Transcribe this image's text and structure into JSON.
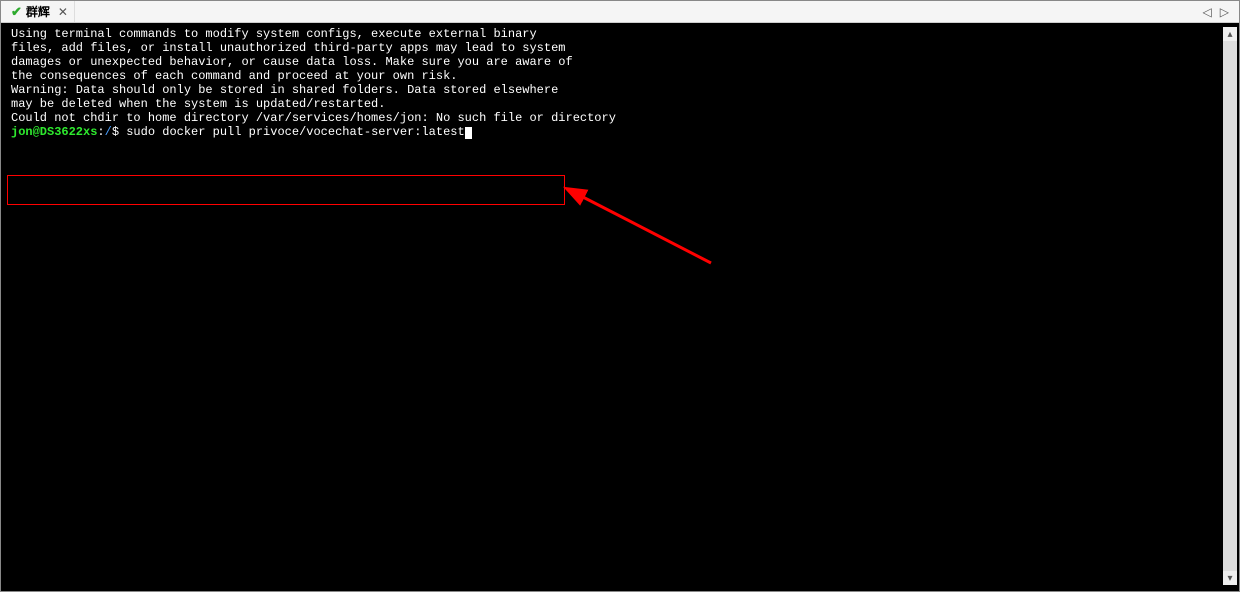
{
  "tab": {
    "title": "群辉"
  },
  "terminal": {
    "motd": [
      "",
      "Using terminal commands to modify system configs, execute external binary",
      "files, add files, or install unauthorized third-party apps may lead to system",
      "damages or unexpected behavior, or cause data loss. Make sure you are aware of",
      "the consequences of each command and proceed at your own risk.",
      "",
      "Warning: Data should only be stored in shared folders. Data stored elsewhere",
      "may be deleted when the system is updated/restarted.",
      "",
      "Could not chdir to home directory /var/services/homes/jon: No such file or directory"
    ],
    "prompt": {
      "userhost": "jon@DS3622xs",
      "sep": ":",
      "path": "/",
      "symbol": "$"
    },
    "command": "sudo docker pull privoce/vocechat-server:latest"
  },
  "annotation": {
    "highlight_color": "#ff0000",
    "arrow_color": "#ff0000"
  }
}
